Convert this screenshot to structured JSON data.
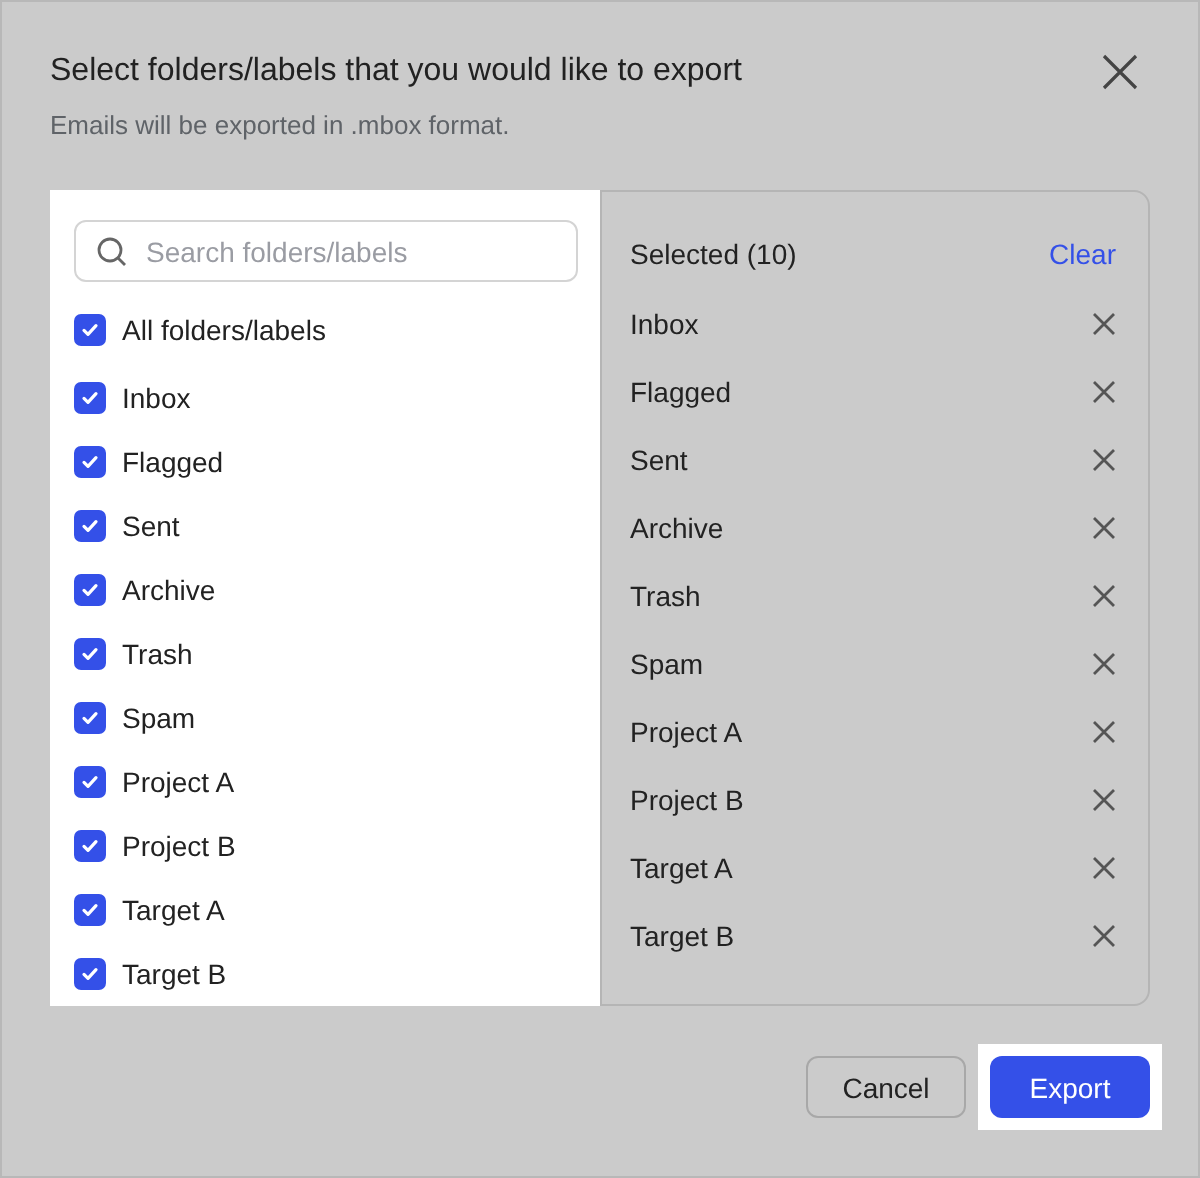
{
  "dialog": {
    "title": "Select folders/labels that you would like to export",
    "subtitle": "Emails will be exported in .mbox format."
  },
  "search": {
    "placeholder": "Search folders/labels"
  },
  "all_item": {
    "label": "All folders/labels",
    "checked": true
  },
  "folders": [
    {
      "label": "Inbox",
      "checked": true
    },
    {
      "label": "Flagged",
      "checked": true
    },
    {
      "label": "Sent",
      "checked": true
    },
    {
      "label": "Archive",
      "checked": true
    },
    {
      "label": "Trash",
      "checked": true
    },
    {
      "label": "Spam",
      "checked": true
    },
    {
      "label": "Project A",
      "checked": true
    },
    {
      "label": "Project B",
      "checked": true
    },
    {
      "label": "Target A",
      "checked": true
    },
    {
      "label": "Target B",
      "checked": true
    }
  ],
  "selected": {
    "heading": "Selected (10)",
    "clear": "Clear",
    "items": [
      "Inbox",
      "Flagged",
      "Sent",
      "Archive",
      "Trash",
      "Spam",
      "Project A",
      "Project B",
      "Target A",
      "Target B"
    ]
  },
  "buttons": {
    "cancel": "Cancel",
    "export": "Export"
  }
}
